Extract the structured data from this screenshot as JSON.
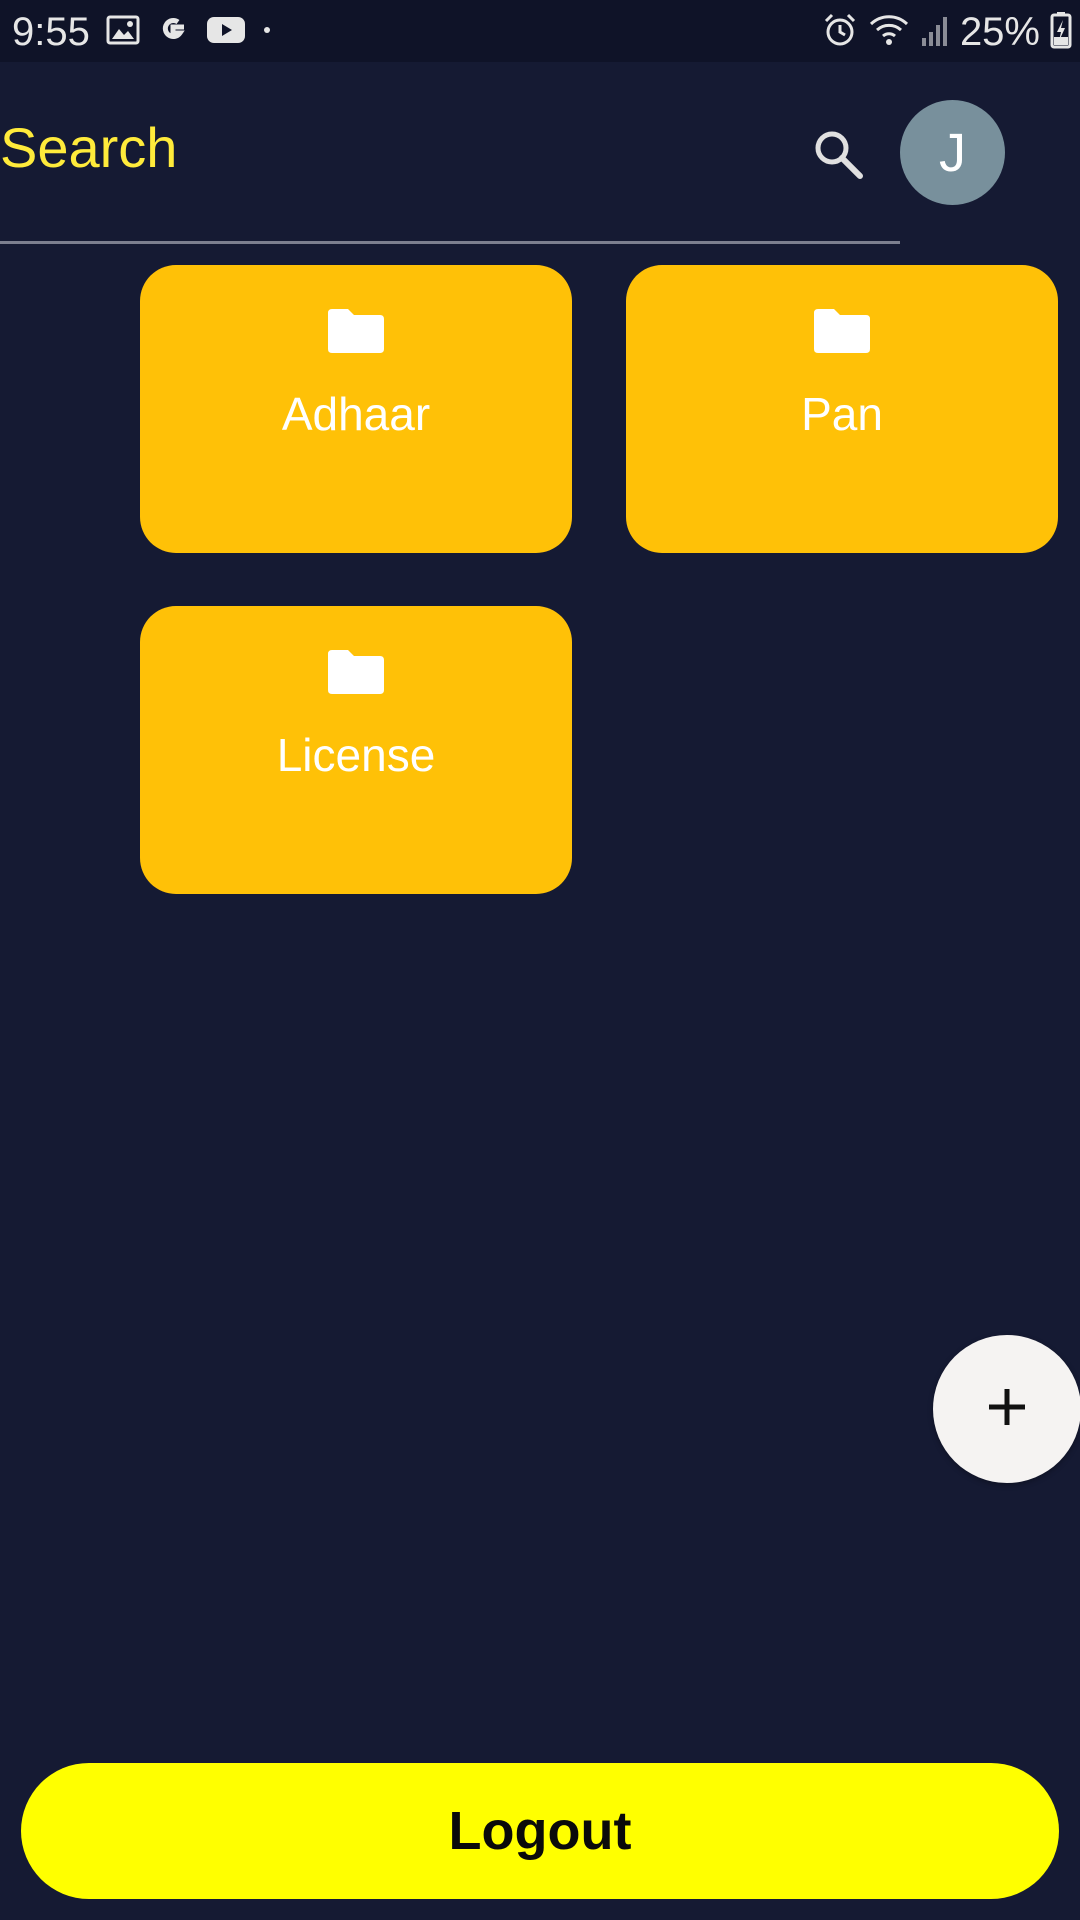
{
  "status_bar": {
    "time": "9:55",
    "battery": "25%",
    "left_icons": [
      "image-icon",
      "google-icon",
      "youtube-icon",
      "dot-icon"
    ],
    "right_icons": [
      "alarm-icon",
      "wifi-icon",
      "signal-icon",
      "battery-charging-icon"
    ]
  },
  "header": {
    "search_placeholder": "Search",
    "avatar_initial": "J",
    "accent_color": "#ffeb3b"
  },
  "folders": [
    {
      "label": "Adhaar",
      "icon": "folder-icon"
    },
    {
      "label": "Pan",
      "icon": "folder-icon"
    },
    {
      "label": "License",
      "icon": "folder-icon"
    }
  ],
  "fab": {
    "icon": "plus-icon"
  },
  "logout": {
    "label": "Logout"
  },
  "colors": {
    "background": "#151a33",
    "card": "#ffc107",
    "logout": "#ffff00",
    "avatar": "#78909c"
  }
}
